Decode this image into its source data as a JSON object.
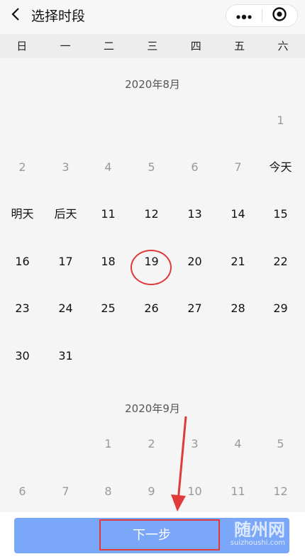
{
  "header": {
    "title": "选择时段",
    "back_icon": "chevron-left-icon",
    "more_icon": "more-dots-icon",
    "close_icon": "target-close-icon"
  },
  "weekdays": [
    "日",
    "一",
    "二",
    "三",
    "四",
    "五",
    "六"
  ],
  "months": [
    {
      "title": "2020年8月",
      "days": [
        {
          "label": "1",
          "past": true
        },
        {
          "label": "2",
          "past": true
        },
        {
          "label": "3",
          "past": true
        },
        {
          "label": "4",
          "past": true
        },
        {
          "label": "5",
          "past": true
        },
        {
          "label": "6",
          "past": true
        },
        {
          "label": "7",
          "past": true
        },
        {
          "label": "今天",
          "past": false
        },
        {
          "label": "明天",
          "past": false
        },
        {
          "label": "后天",
          "past": false
        },
        {
          "label": "11",
          "past": false
        },
        {
          "label": "12",
          "past": false
        },
        {
          "label": "13",
          "past": false
        },
        {
          "label": "14",
          "past": false
        },
        {
          "label": "15",
          "past": false
        },
        {
          "label": "16",
          "past": false
        },
        {
          "label": "17",
          "past": false
        },
        {
          "label": "18",
          "past": false
        },
        {
          "label": "19",
          "past": false
        },
        {
          "label": "20",
          "past": false
        },
        {
          "label": "21",
          "past": false
        },
        {
          "label": "22",
          "past": false
        },
        {
          "label": "23",
          "past": false
        },
        {
          "label": "24",
          "past": false
        },
        {
          "label": "25",
          "past": false
        },
        {
          "label": "26",
          "past": false
        },
        {
          "label": "27",
          "past": false
        },
        {
          "label": "28",
          "past": false
        },
        {
          "label": "29",
          "past": false
        },
        {
          "label": "30",
          "past": false
        },
        {
          "label": "31",
          "past": false
        }
      ]
    },
    {
      "title": "2020年9月",
      "days": [
        {
          "label": "1",
          "past": true
        },
        {
          "label": "2",
          "past": true
        },
        {
          "label": "3",
          "past": true
        },
        {
          "label": "4",
          "past": true
        },
        {
          "label": "5",
          "past": true
        },
        {
          "label": "6",
          "past": true
        },
        {
          "label": "7",
          "past": true
        },
        {
          "label": "8",
          "past": true
        },
        {
          "label": "9",
          "past": true
        },
        {
          "label": "10",
          "past": true
        },
        {
          "label": "11",
          "past": true
        },
        {
          "label": "12",
          "past": true
        }
      ]
    }
  ],
  "next_button": {
    "label": "下一步"
  },
  "watermark": {
    "main": "随州网",
    "sub": "suizhoushi.com"
  },
  "colors": {
    "accent": "#7aa7f7",
    "annotation": "#e03a3a"
  }
}
